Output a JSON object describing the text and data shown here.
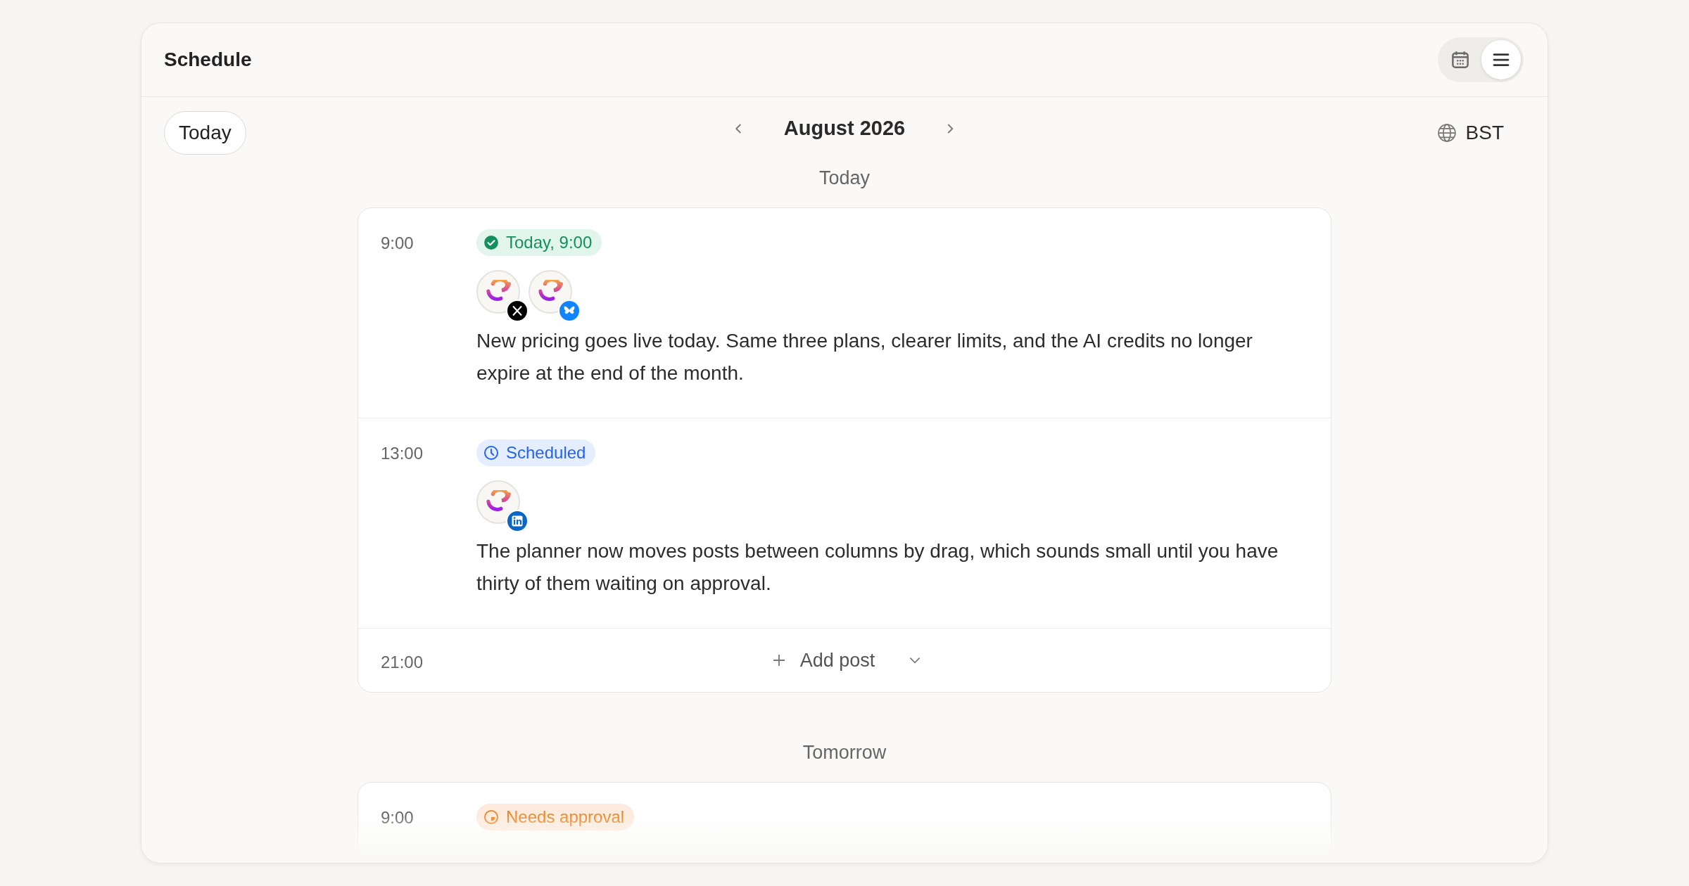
{
  "header": {
    "title": "Schedule",
    "views": [
      {
        "kind": "calendar",
        "selected": false
      },
      {
        "kind": "list",
        "selected": true
      }
    ]
  },
  "toolbar": {
    "today_button": "Today",
    "month": "August 2026",
    "timezone": "BST"
  },
  "days": [
    {
      "label": "Today",
      "slots": [
        {
          "kind": "post",
          "time": "9:00",
          "status": {
            "kind": "published",
            "label": "Today, 9:00"
          },
          "accounts": [
            {
              "kind": "x"
            },
            {
              "kind": "bluesky"
            }
          ],
          "text": "New pricing goes live today. Same three plans, clearer limits, and the AI credits no longer expire at the end of the month."
        },
        {
          "kind": "post",
          "time": "13:00",
          "status": {
            "kind": "scheduled",
            "label": "Scheduled"
          },
          "accounts": [
            {
              "kind": "linkedin"
            }
          ],
          "text": "The planner now moves posts between columns by drag, which sounds small until you have thirty of them waiting on approval."
        },
        {
          "kind": "empty",
          "time": "21:00",
          "action": "Add post"
        }
      ]
    },
    {
      "label": "Tomorrow",
      "slots": [
        {
          "kind": "post",
          "time": "9:00",
          "status": {
            "kind": "approval",
            "label": "Needs approval"
          }
        }
      ]
    }
  ]
}
